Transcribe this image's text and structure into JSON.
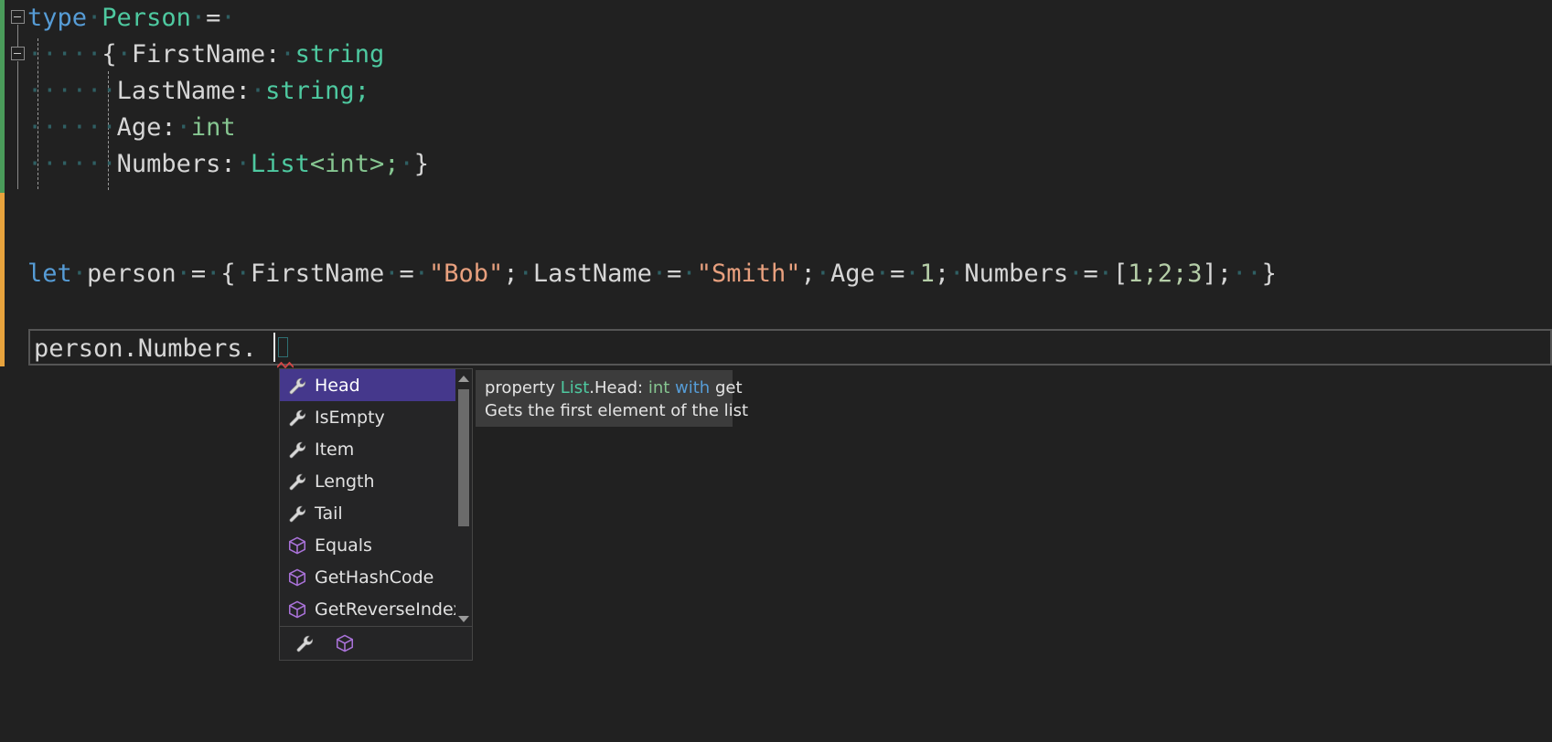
{
  "editor": {
    "lines": [
      {
        "id": "l1",
        "tokens": [
          {
            "t": "type",
            "c": "kw"
          },
          {
            "t": "·",
            "c": "ws"
          },
          {
            "t": "Person",
            "c": "typ"
          },
          {
            "t": "·",
            "c": "ws"
          },
          {
            "t": "=",
            "c": "punc"
          },
          {
            "t": "·",
            "c": "ws"
          }
        ]
      },
      {
        "id": "l2",
        "tokens": [
          {
            "t": "·",
            "c": "ws"
          },
          {
            "t": "···",
            "c": "ws"
          },
          {
            "t": "·",
            "c": "ws"
          },
          {
            "t": "{",
            "c": "punc"
          },
          {
            "t": "·",
            "c": "ws"
          },
          {
            "t": "FirstName:",
            "c": "id"
          },
          {
            "t": "·",
            "c": "ws"
          },
          {
            "t": "string",
            "c": "typ"
          }
        ]
      },
      {
        "id": "l3",
        "tokens": [
          {
            "t": "·",
            "c": "ws"
          },
          {
            "t": "···",
            "c": "ws"
          },
          {
            "t": "·",
            "c": "ws"
          },
          {
            "t": "·",
            "c": "ws"
          },
          {
            "t": "LastName:",
            "c": "id"
          },
          {
            "t": "·",
            "c": "ws"
          },
          {
            "t": "string;",
            "c": "typ"
          }
        ]
      },
      {
        "id": "l4",
        "tokens": [
          {
            "t": "·",
            "c": "ws"
          },
          {
            "t": "···",
            "c": "ws"
          },
          {
            "t": "·",
            "c": "ws"
          },
          {
            "t": "·",
            "c": "ws"
          },
          {
            "t": "Age:",
            "c": "id"
          },
          {
            "t": "·",
            "c": "ws"
          },
          {
            "t": "int",
            "c": "prim"
          }
        ]
      },
      {
        "id": "l5",
        "tokens": [
          {
            "t": "·",
            "c": "ws"
          },
          {
            "t": "···",
            "c": "ws"
          },
          {
            "t": "·",
            "c": "ws"
          },
          {
            "t": "·",
            "c": "ws"
          },
          {
            "t": "Numbers:",
            "c": "id"
          },
          {
            "t": "·",
            "c": "ws"
          },
          {
            "t": "List",
            "c": "typ"
          },
          {
            "t": "<int>;",
            "c": "prim"
          },
          {
            "t": "·",
            "c": "ws"
          },
          {
            "t": "}",
            "c": "punc"
          }
        ]
      },
      {
        "id": "l6",
        "tokens": []
      },
      {
        "id": "l7",
        "tokens": []
      },
      {
        "id": "l8",
        "tokens": [
          {
            "t": "let",
            "c": "kw"
          },
          {
            "t": "·",
            "c": "ws"
          },
          {
            "t": "person",
            "c": "id"
          },
          {
            "t": "·",
            "c": "ws"
          },
          {
            "t": "=",
            "c": "punc"
          },
          {
            "t": "·",
            "c": "ws"
          },
          {
            "t": "{",
            "c": "punc"
          },
          {
            "t": "·",
            "c": "ws"
          },
          {
            "t": "FirstName",
            "c": "id"
          },
          {
            "t": "·",
            "c": "ws"
          },
          {
            "t": "=",
            "c": "punc"
          },
          {
            "t": "·",
            "c": "ws"
          },
          {
            "t": "\"Bob\"",
            "c": "str"
          },
          {
            "t": ";",
            "c": "punc"
          },
          {
            "t": "·",
            "c": "ws"
          },
          {
            "t": "LastName",
            "c": "id"
          },
          {
            "t": "·",
            "c": "ws"
          },
          {
            "t": "=",
            "c": "punc"
          },
          {
            "t": "·",
            "c": "ws"
          },
          {
            "t": "\"Smith\"",
            "c": "str"
          },
          {
            "t": ";",
            "c": "punc"
          },
          {
            "t": "·",
            "c": "ws"
          },
          {
            "t": "Age",
            "c": "id"
          },
          {
            "t": "·",
            "c": "ws"
          },
          {
            "t": "=",
            "c": "punc"
          },
          {
            "t": "·",
            "c": "ws"
          },
          {
            "t": "1",
            "c": "num"
          },
          {
            "t": ";",
            "c": "punc"
          },
          {
            "t": "·",
            "c": "ws"
          },
          {
            "t": "Numbers",
            "c": "id"
          },
          {
            "t": "·",
            "c": "ws"
          },
          {
            "t": "=",
            "c": "punc"
          },
          {
            "t": "·",
            "c": "ws"
          },
          {
            "t": "[",
            "c": "punc"
          },
          {
            "t": "1;2;3",
            "c": "num"
          },
          {
            "t": "]",
            "c": "punc"
          },
          {
            "t": ";",
            "c": "punc"
          },
          {
            "t": "·",
            "c": "ws"
          },
          {
            "t": "·",
            "c": "ws"
          },
          {
            "t": "}",
            "c": "punc"
          }
        ]
      }
    ],
    "input_line": {
      "value": "person.Numbers.",
      "placeholder": ""
    },
    "full_source_text": "type Person =\n    { FirstName: string\n      LastName: string;\n      Age: int\n      Numbers: List<int>; }\n\n\nlet person = { FirstName = \"Bob\"; LastName = \"Smith\"; Age = 1; Numbers = [1;2;3];  }\n\nperson.Numbers."
  },
  "autocomplete": {
    "items": [
      {
        "label": "Head",
        "icon": "wrench-icon",
        "kind": "property",
        "selected": true
      },
      {
        "label": "IsEmpty",
        "icon": "wrench-icon",
        "kind": "property",
        "selected": false
      },
      {
        "label": "Item",
        "icon": "wrench-icon",
        "kind": "property",
        "selected": false
      },
      {
        "label": "Length",
        "icon": "wrench-icon",
        "kind": "property",
        "selected": false
      },
      {
        "label": "Tail",
        "icon": "wrench-icon",
        "kind": "property",
        "selected": false
      },
      {
        "label": "Equals",
        "icon": "cube-icon",
        "kind": "method",
        "selected": false
      },
      {
        "label": "GetHashCode",
        "icon": "cube-icon",
        "kind": "method",
        "selected": false
      },
      {
        "label": "GetReverseIndex",
        "icon": "cube-icon",
        "kind": "method",
        "selected": false
      }
    ],
    "footer_filters": [
      {
        "icon": "wrench-icon",
        "name": "filter-properties"
      },
      {
        "icon": "cube-icon",
        "name": "filter-methods"
      }
    ],
    "scrollbar": {
      "up_arrow": "scroll-up-arrow",
      "down_arrow": "scroll-down-arrow"
    },
    "selected_color": "#45388c"
  },
  "tooltip": {
    "signature": [
      {
        "t": "property ",
        "c": ""
      },
      {
        "t": "List",
        "c": "tt-type"
      },
      {
        "t": ".Head: ",
        "c": ""
      },
      {
        "t": "int",
        "c": "tt-prim"
      },
      {
        "t": " ",
        "c": ""
      },
      {
        "t": "with",
        "c": "tt-kw"
      },
      {
        "t": " get",
        "c": ""
      }
    ],
    "signature_text": "property List.Head: int with get",
    "description": "Gets the first element of the list"
  },
  "colors": {
    "background": "#212121",
    "keyword": "#569cd6",
    "type": "#4ec9a0",
    "primitive": "#86c691",
    "string": "#e8a07e",
    "number": "#b5cea8",
    "identifier": "#d6d6d6",
    "whitespace_dot": "#2f5f63",
    "selection": "#45388c",
    "tooltip_bg": "#3c3c3c",
    "changebar_added": "#4a9c5a",
    "changebar_modified": "#e8a33d",
    "error_squiggle": "#d14545"
  }
}
